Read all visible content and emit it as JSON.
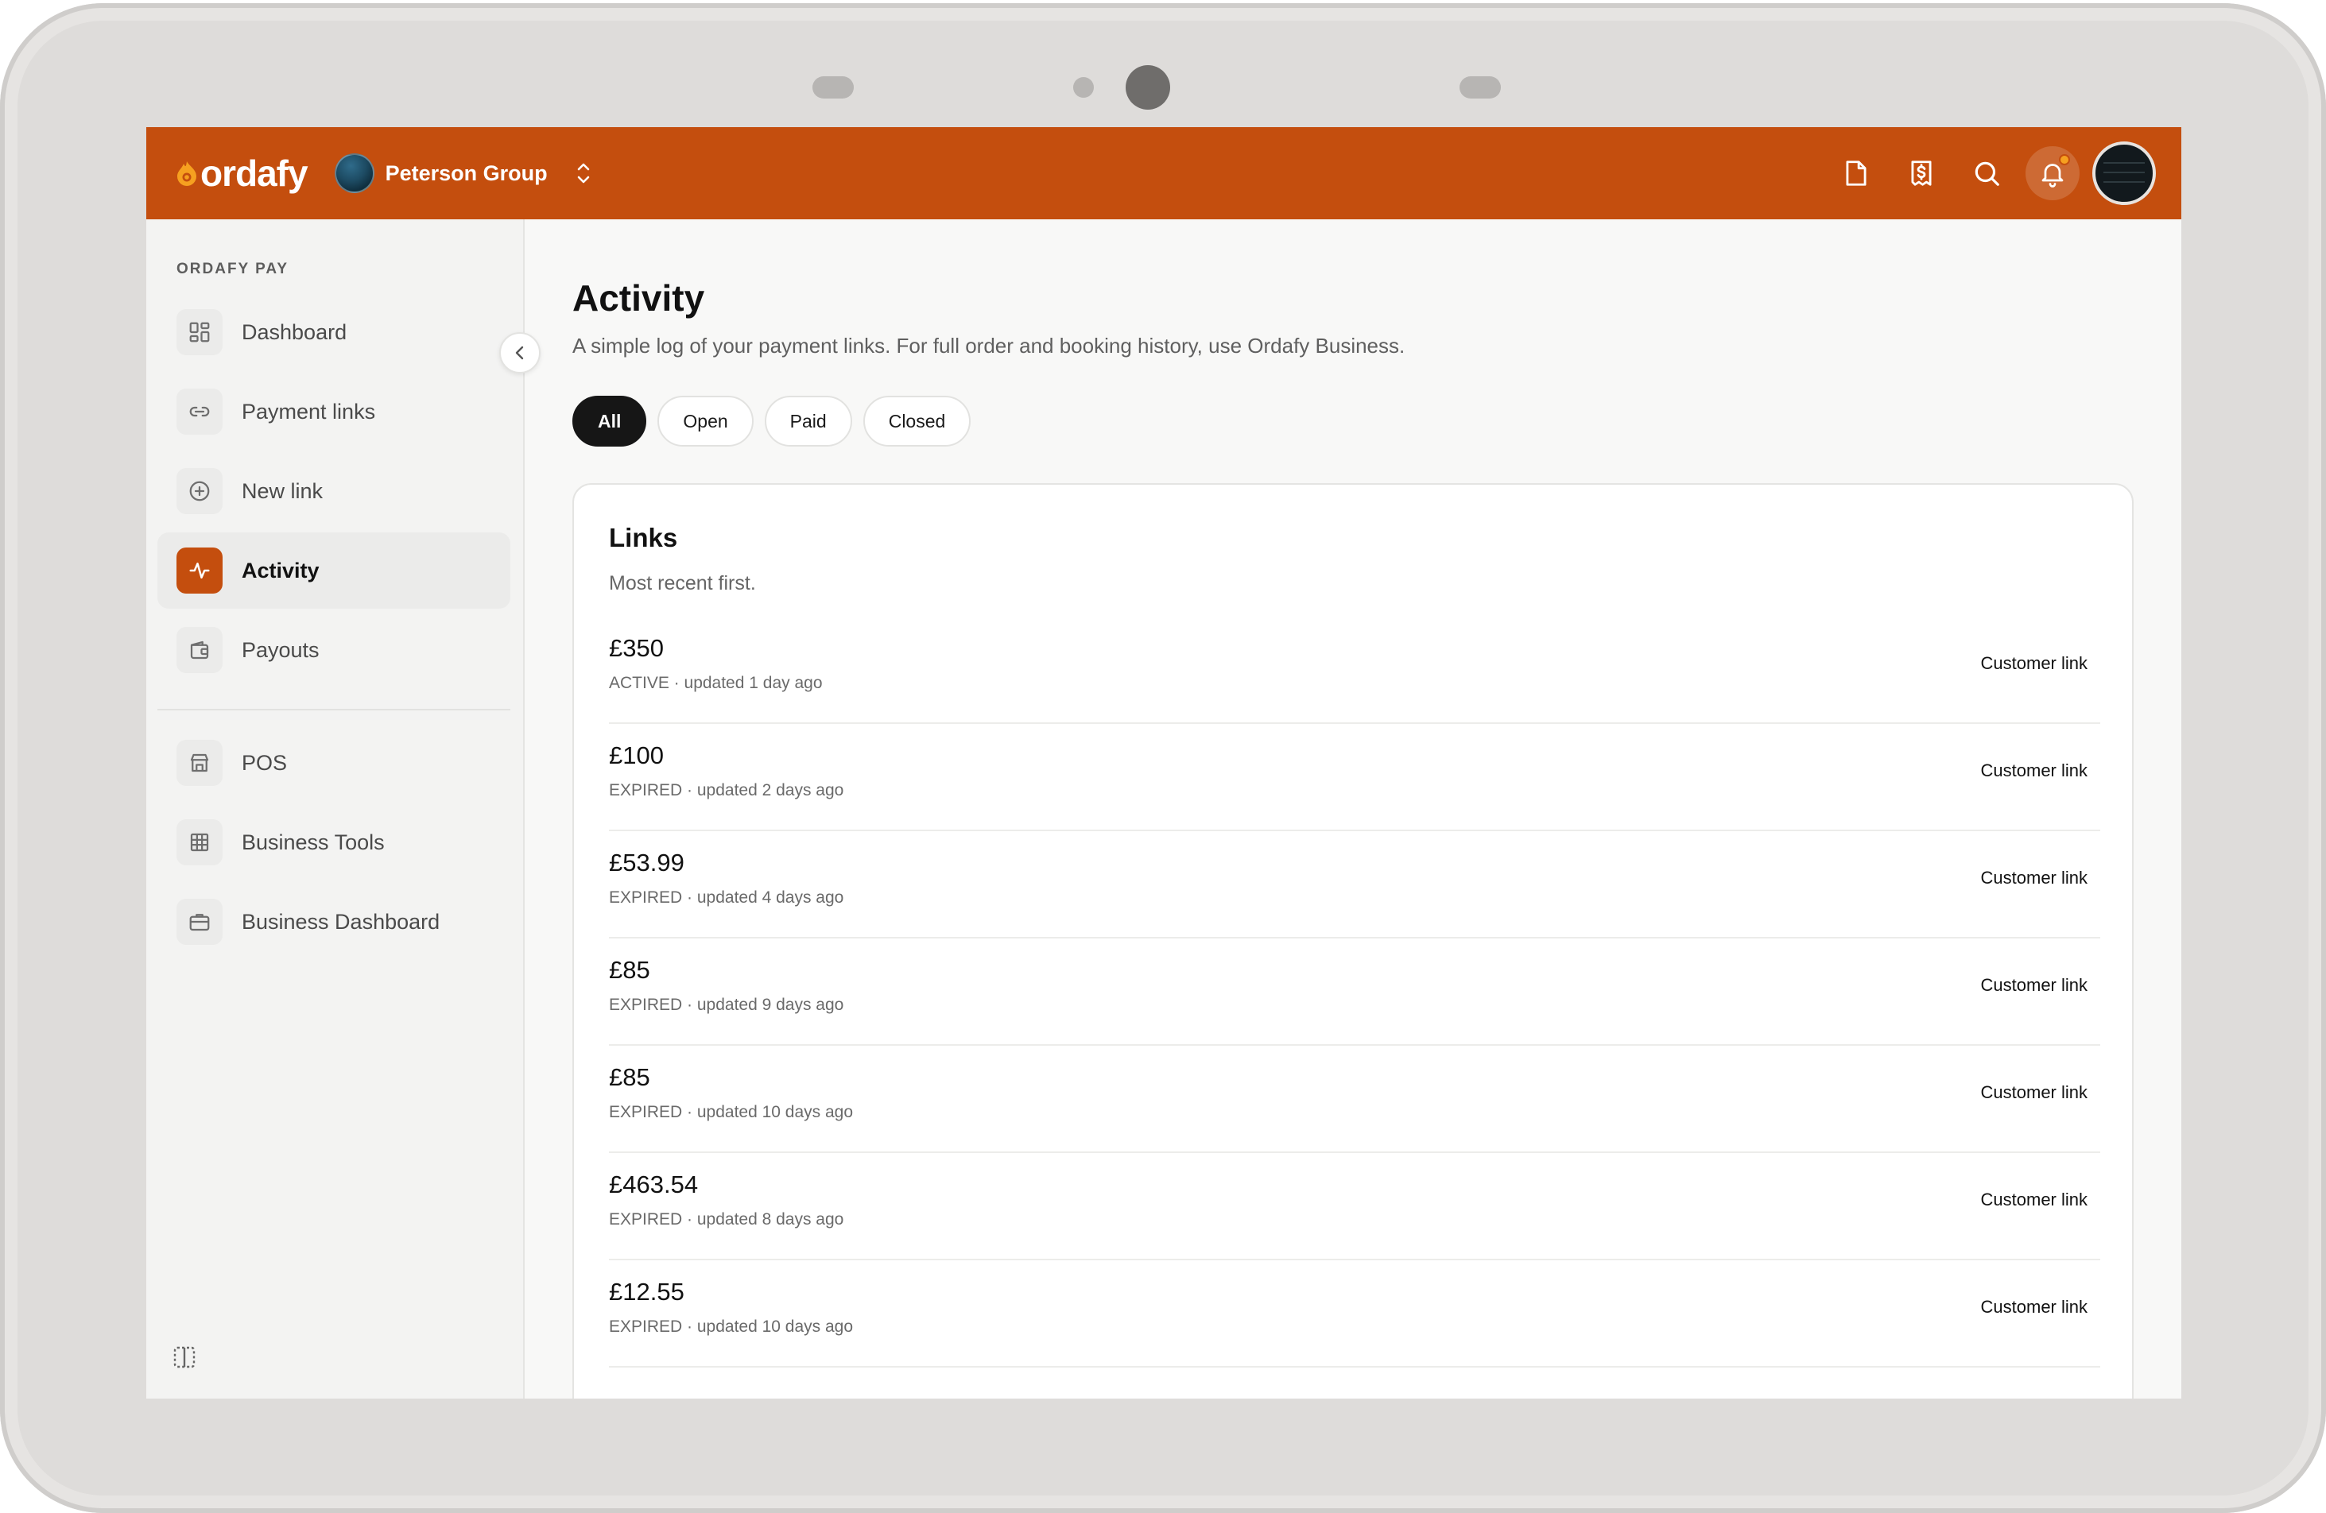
{
  "app": {
    "brand": "ordafy",
    "org_name": "Peterson Group"
  },
  "topbar": {
    "icons": [
      "document-icon",
      "receipt-icon",
      "search-icon",
      "bell-icon"
    ],
    "accent_color": "#c44e0e",
    "has_notification": true
  },
  "sidebar": {
    "caption": "ORDAFY PAY",
    "items": [
      {
        "label": "Dashboard",
        "icon": "dashboard-grid-icon",
        "active": false
      },
      {
        "label": "Payment links",
        "icon": "link-icon",
        "active": false
      },
      {
        "label": "New link",
        "icon": "plus-circle-icon",
        "active": false
      },
      {
        "label": "Activity",
        "icon": "activity-pulse-icon",
        "active": true
      },
      {
        "label": "Payouts",
        "icon": "wallet-icon",
        "active": false
      }
    ],
    "secondary_items": [
      {
        "label": "POS",
        "icon": "store-icon"
      },
      {
        "label": "Business Tools",
        "icon": "table-grid-icon"
      },
      {
        "label": "Business Dashboard",
        "icon": "briefcase-icon"
      }
    ]
  },
  "main": {
    "title": "Activity",
    "subtitle": "A simple log of your payment links. For full order and booking history, use Ordafy Business.",
    "filters": [
      {
        "label": "All",
        "active": true
      },
      {
        "label": "Open",
        "active": false
      },
      {
        "label": "Paid",
        "active": false
      },
      {
        "label": "Closed",
        "active": false
      }
    ],
    "card": {
      "title": "Links",
      "subtitle": "Most recent first.",
      "rows": [
        {
          "amount": "£350",
          "meta": "ACTIVE · updated 1 day ago",
          "link": "Customer link"
        },
        {
          "amount": "£100",
          "meta": "EXPIRED · updated 2 days ago",
          "link": "Customer link"
        },
        {
          "amount": "£53.99",
          "meta": "EXPIRED · updated 4 days ago",
          "link": "Customer link"
        },
        {
          "amount": "£85",
          "meta": "EXPIRED · updated 9 days ago",
          "link": "Customer link"
        },
        {
          "amount": "£85",
          "meta": "EXPIRED · updated 10 days ago",
          "link": "Customer link"
        },
        {
          "amount": "£463.54",
          "meta": "EXPIRED · updated 8 days ago",
          "link": "Customer link"
        },
        {
          "amount": "£12.55",
          "meta": "EXPIRED · updated 10 days ago",
          "link": "Customer link"
        }
      ]
    }
  }
}
